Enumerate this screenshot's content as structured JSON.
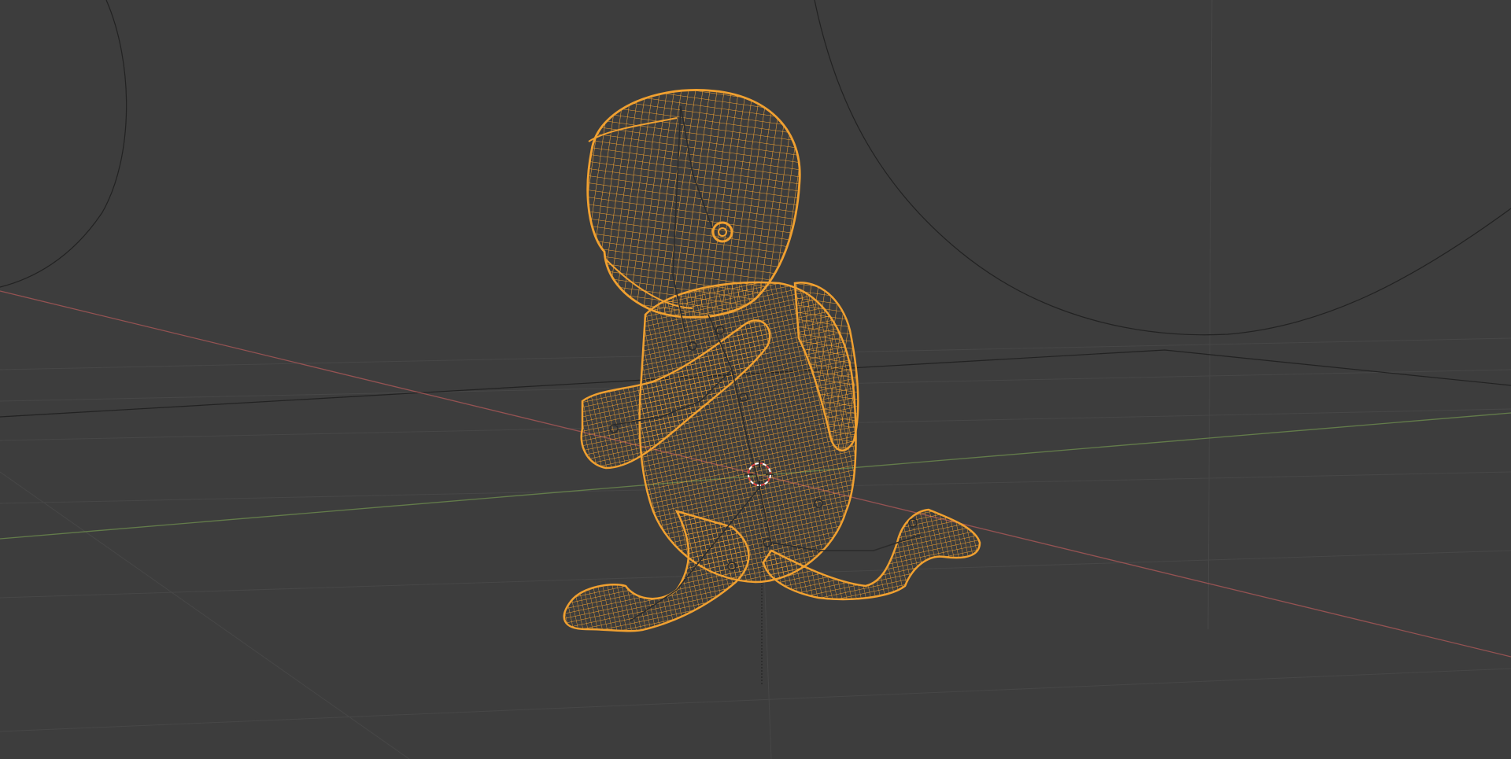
{
  "viewport": {
    "background": "#3d3d3d",
    "grid_color": "#4a4a4a",
    "x_axis_color": "#b35a5a",
    "y_axis_color": "#6d8c4e",
    "selection_color": "#f0a030",
    "armature_color": "#2b2b2b",
    "scene_line_color": "#222222"
  },
  "objects": {
    "character": "wireframe-character",
    "origin_icon": "object-origin-icon",
    "cursor_icon": "3d-cursor-icon"
  }
}
